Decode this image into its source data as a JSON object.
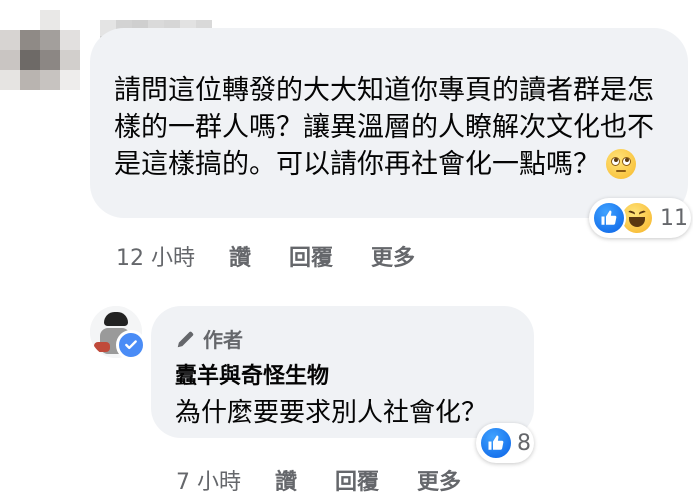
{
  "comment1": {
    "text": "請問這位轉發的大大知道你專頁的讀者群是怎樣的一群人嗎？讓異溫層的人瞭解次文化也不是這樣搞的。可以請你再社會化一點嗎？",
    "emoji": "face-with-rolling-eyes",
    "reactions": {
      "types": [
        "like",
        "haha"
      ],
      "count": "11"
    },
    "time": "12 小時",
    "actions": {
      "like": "讚",
      "reply": "回覆",
      "more": "更多"
    }
  },
  "comment2": {
    "author_badge": "作者",
    "author_name": "蠹羊與奇怪生物",
    "text": "為什麼要要求別人社會化？",
    "reactions": {
      "types": [
        "like"
      ],
      "count": "8"
    },
    "time": "7 小時",
    "actions": {
      "like": "讚",
      "reply": "回覆",
      "more": "更多"
    }
  },
  "colors": {
    "bubble": "#f0f2f5",
    "secondary_text": "#65676b",
    "like_blue": "#1877f2",
    "verified_blue": "#4a8cf6"
  }
}
